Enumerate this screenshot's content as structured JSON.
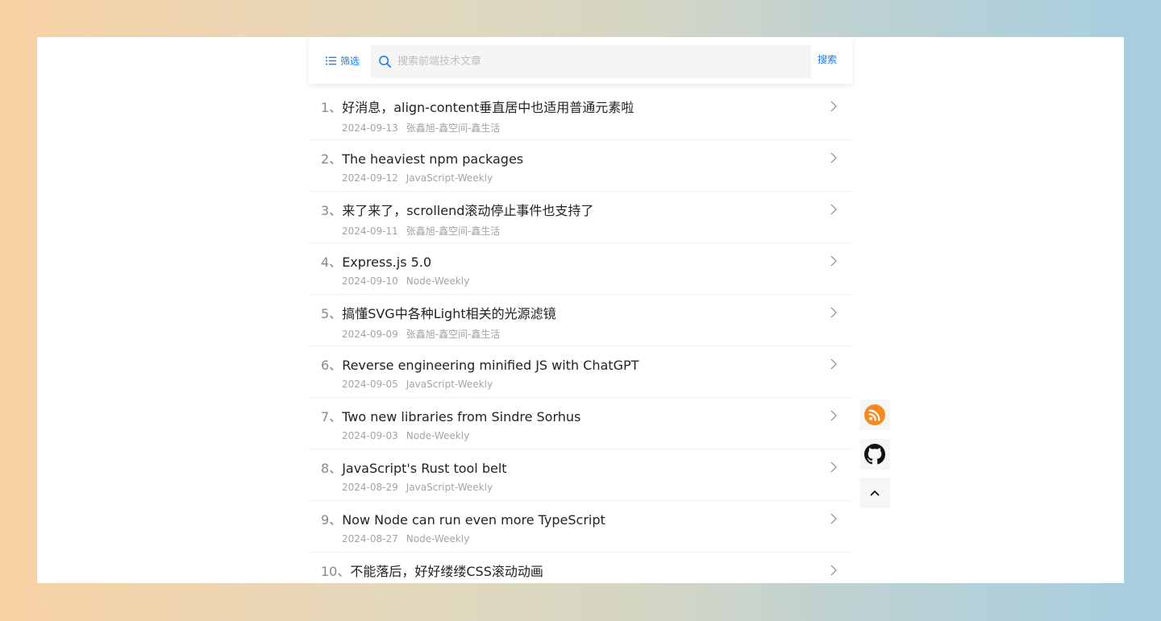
{
  "toolbar": {
    "filter_label": "筛选",
    "search_placeholder": "搜索前端技术文章",
    "search_value": "",
    "search_button": "搜索"
  },
  "articles": [
    {
      "index": "1、",
      "title": "好消息，align-content垂直居中也适用普通元素啦",
      "date": "2024-09-13",
      "source": "张鑫旭-鑫空间-鑫生活"
    },
    {
      "index": "2、",
      "title": "The heaviest npm packages",
      "date": "2024-09-12",
      "source": "JavaScript-Weekly"
    },
    {
      "index": "3、",
      "title": "来了来了，scrollend滚动停止事件也支持了",
      "date": "2024-09-11",
      "source": "张鑫旭-鑫空间-鑫生活"
    },
    {
      "index": "4、",
      "title": "Express.js 5.0",
      "date": "2024-09-10",
      "source": "Node-Weekly"
    },
    {
      "index": "5、",
      "title": "搞懂SVG中各种Light相关的光源滤镜",
      "date": "2024-09-09",
      "source": "张鑫旭-鑫空间-鑫生活"
    },
    {
      "index": "6、",
      "title": "Reverse engineering minified JS with ChatGPT",
      "date": "2024-09-05",
      "source": "JavaScript-Weekly"
    },
    {
      "index": "7、",
      "title": "Two new libraries from Sindre Sorhus",
      "date": "2024-09-03",
      "source": "Node-Weekly"
    },
    {
      "index": "8、",
      "title": "JavaScript's Rust tool belt",
      "date": "2024-08-29",
      "source": "JavaScript-Weekly"
    },
    {
      "index": "9、",
      "title": "Now Node can run even more TypeScript",
      "date": "2024-08-27",
      "source": "Node-Weekly"
    },
    {
      "index": "10、",
      "title": "不能落后，好好缕缕CSS滚动动画",
      "date": "",
      "source": ""
    }
  ],
  "side_buttons": {
    "rss_icon": "rss-icon",
    "github_icon": "github-icon",
    "top_icon": "chevron-up-icon"
  },
  "colors": {
    "accent": "#1677ff",
    "rss": "#f6891f",
    "meta_text": "#a3a3a3"
  }
}
